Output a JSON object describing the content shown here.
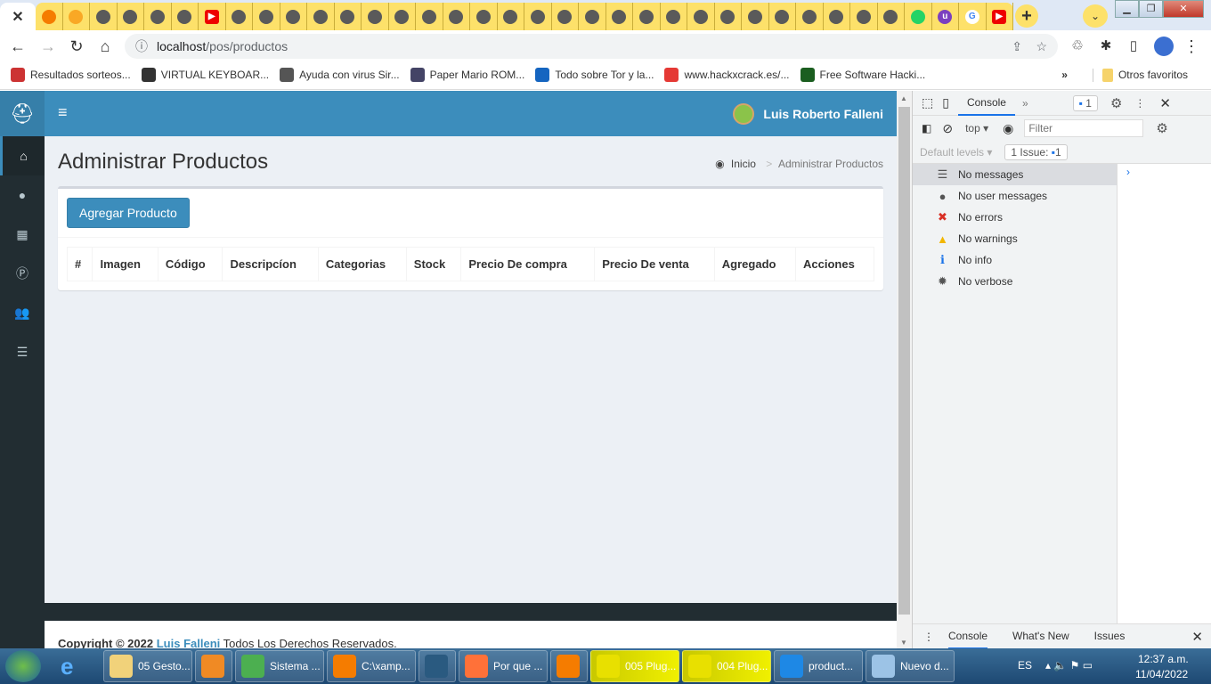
{
  "browser": {
    "tab_icons": [
      "xampp",
      "phpmyadmin",
      "globe",
      "globe",
      "globe",
      "globe",
      "youtube",
      "globe",
      "globe",
      "globe",
      "globe",
      "globe",
      "globe",
      "globe",
      "globe",
      "globe",
      "globe",
      "globe",
      "globe",
      "globe",
      "globe",
      "globe",
      "globe",
      "globe",
      "globe",
      "globe",
      "globe",
      "globe",
      "globe",
      "globe",
      "globe",
      "globe",
      "whatsapp",
      "ublock",
      "google",
      "youtube"
    ],
    "active_tab_close": "✕",
    "new_tab": "+",
    "url_host": "localhost",
    "url_path": "/pos/productos",
    "bookmarks": [
      {
        "label": "Resultados sorteos...",
        "color": "#c33"
      },
      {
        "label": "VIRTUAL KEYBOAR...",
        "color": "#333"
      },
      {
        "label": "Ayuda con virus Sir...",
        "color": "#555"
      },
      {
        "label": "Paper Mario ROM...",
        "color": "#446"
      },
      {
        "label": "Todo sobre Tor y la...",
        "color": "#1565c0"
      },
      {
        "label": "www.hackxcrack.es/...",
        "color": "#e53935"
      },
      {
        "label": "Free Software Hacki...",
        "color": "#1b5e20"
      }
    ],
    "more_bookmarks": "»",
    "other_bookmarks": "Otros favoritos"
  },
  "app": {
    "user_name": "Luis Roberto Falleni",
    "page_title": "Administrar Productos",
    "breadcrumb": {
      "home": "Inicio",
      "separator": ">",
      "current": "Administrar Productos"
    },
    "add_button": "Agregar Producto",
    "table_headers": [
      "#",
      "Imagen",
      "Código",
      "Descripcíon",
      "Categorias",
      "Stock",
      "Precio De compra",
      "Precio De venta",
      "Agregado",
      "Acciones"
    ],
    "sidebar_icons": [
      "home",
      "user",
      "th",
      "product-p",
      "users",
      "list"
    ],
    "footer": {
      "prefix": "Copyright © 2022",
      "author": "Luis Falleni",
      "suffix": "Todos Los Derechos Reservados."
    },
    "accent": "#3c8dbc"
  },
  "devtools": {
    "tab": "Console",
    "issues_badge": "1",
    "context": "top",
    "filter_placeholder": "Filter",
    "levels": "Default levels",
    "issue_label": "1 Issue:",
    "issue_count": "1",
    "messages": [
      {
        "icon": "list",
        "label": "No messages"
      },
      {
        "icon": "user-circle",
        "label": "No user messages"
      },
      {
        "icon": "error",
        "label": "No errors"
      },
      {
        "icon": "warning",
        "label": "No warnings"
      },
      {
        "icon": "info",
        "label": "No info"
      },
      {
        "icon": "bug",
        "label": "No verbose"
      }
    ],
    "drawer_tabs": [
      "Console",
      "What's New",
      "Issues"
    ]
  },
  "taskbar": {
    "items": [
      {
        "label": "05 Gesto...",
        "icon": "folder"
      },
      {
        "label": "",
        "icon": "media-player"
      },
      {
        "label": "Sistema ...",
        "icon": "chrome"
      },
      {
        "label": "C:\\xamp...",
        "icon": "sublime"
      },
      {
        "label": "",
        "icon": "mysql-workbench"
      },
      {
        "label": "Por que ...",
        "icon": "firefox"
      },
      {
        "label": "",
        "icon": "xampp"
      },
      {
        "label": "005 Plug...",
        "icon": "video"
      },
      {
        "label": "004 Plug...",
        "icon": "video"
      },
      {
        "label": "product...",
        "icon": "vscode"
      },
      {
        "label": "Nuevo d...",
        "icon": "notepad"
      }
    ],
    "lang": "ES",
    "time": "12:37 a.m.",
    "date": "11/04/2022"
  }
}
